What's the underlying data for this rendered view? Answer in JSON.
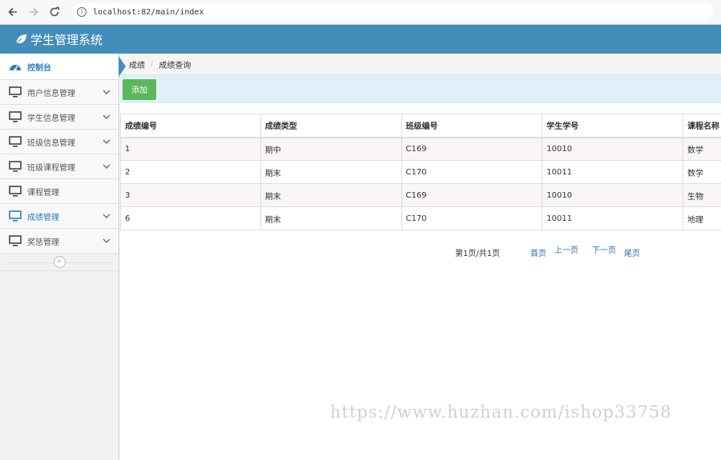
{
  "browser": {
    "url": "localhost:82/main/index",
    "back_icon": "arrow-left-icon",
    "forward_icon": "arrow-right-icon",
    "reload_icon": "reload-icon"
  },
  "header": {
    "title": "学生管理系统",
    "icon": "leaf-icon",
    "color": "#438eb9"
  },
  "sidebar": {
    "items": [
      {
        "label": "控制台",
        "icon": "dashboard-icon"
      },
      {
        "label": "用户信息管理",
        "icon": "monitor-icon"
      },
      {
        "label": "学生信息管理",
        "icon": "monitor-icon"
      },
      {
        "label": "班级信息管理",
        "icon": "monitor-icon"
      },
      {
        "label": "班级课程管理",
        "icon": "monitor-icon"
      },
      {
        "label": "课程管理",
        "icon": "monitor-icon"
      },
      {
        "label": "成绩管理",
        "icon": "monitor-icon"
      },
      {
        "label": "奖惩管理",
        "icon": "monitor-icon"
      }
    ],
    "collapse_glyph": "«"
  },
  "breadcrumb": {
    "items": [
      "成绩",
      "成绩查询"
    ],
    "separator": "/"
  },
  "toolbar": {
    "add_label": "添加"
  },
  "table": {
    "headers": [
      "成绩编号",
      "成绩类型",
      "班级编号",
      "学生学号",
      "课程名称"
    ],
    "rows": [
      [
        "1",
        "期中",
        "C169",
        "10010",
        "数学"
      ],
      [
        "2",
        "期末",
        "C170",
        "10011",
        "数学"
      ],
      [
        "3",
        "期末",
        "C169",
        "10010",
        "生物"
      ],
      [
        "6",
        "期末",
        "C170",
        "10011",
        "地理"
      ]
    ]
  },
  "pager": {
    "info": "第1页/共1页",
    "first": "首页",
    "prev": "上一页",
    "next": "下一页",
    "last": "尾页"
  },
  "watermark": "https://www.huzhan.com/ishop33758"
}
